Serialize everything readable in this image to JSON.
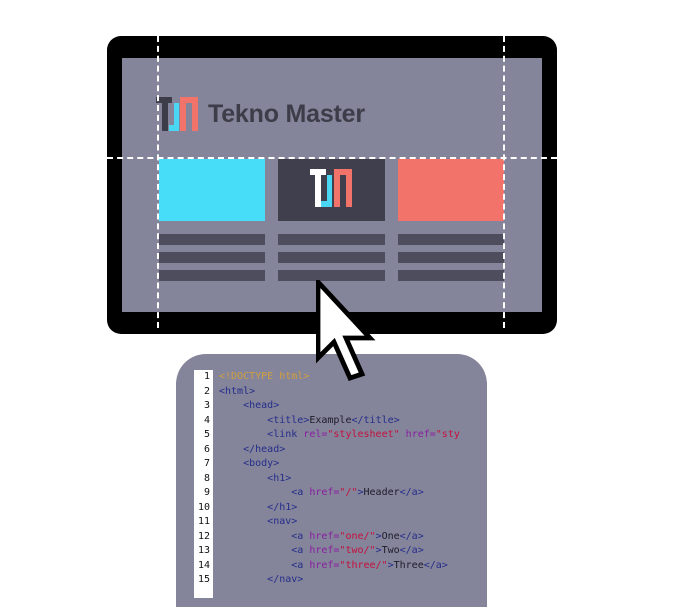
{
  "brand": {
    "name": "Tekno Master"
  },
  "colors": {
    "monitor_frame": "#000000",
    "screen_bg": "#84849a",
    "card_cyan": "#47dcf7",
    "card_dark": "#3f3f4d",
    "card_coral": "#f2736a",
    "text_bars": "#4d4d5e",
    "editor_bg": "#84849a"
  },
  "code": {
    "lines": [
      {
        "n": "1",
        "indent": "",
        "tokens": [
          {
            "k": "d",
            "v": "<!DOCTYPE html>"
          }
        ]
      },
      {
        "n": "2",
        "indent": "",
        "tokens": [
          {
            "k": "t",
            "v": "<html>"
          }
        ]
      },
      {
        "n": "3",
        "indent": "    ",
        "tokens": [
          {
            "k": "t",
            "v": "<head>"
          }
        ]
      },
      {
        "n": "4",
        "indent": "        ",
        "tokens": [
          {
            "k": "t",
            "v": "<title>"
          },
          {
            "k": "p",
            "v": "Example"
          },
          {
            "k": "t",
            "v": "</title>"
          }
        ]
      },
      {
        "n": "5",
        "indent": "        ",
        "tokens": [
          {
            "k": "t",
            "v": "<link "
          },
          {
            "k": "a",
            "v": "rel="
          },
          {
            "k": "s",
            "v": "\"stylesheet\" "
          },
          {
            "k": "a",
            "v": "href="
          },
          {
            "k": "s",
            "v": "\"sty"
          }
        ]
      },
      {
        "n": "6",
        "indent": "    ",
        "tokens": [
          {
            "k": "t",
            "v": "</head>"
          }
        ]
      },
      {
        "n": "7",
        "indent": "    ",
        "tokens": [
          {
            "k": "t",
            "v": "<body>"
          }
        ]
      },
      {
        "n": "8",
        "indent": "        ",
        "tokens": [
          {
            "k": "t",
            "v": "<h1>"
          }
        ]
      },
      {
        "n": "9",
        "indent": "            ",
        "tokens": [
          {
            "k": "t",
            "v": "<a "
          },
          {
            "k": "a",
            "v": "href="
          },
          {
            "k": "s",
            "v": "\"/\""
          },
          {
            "k": "t",
            "v": ">"
          },
          {
            "k": "p",
            "v": "Header"
          },
          {
            "k": "t",
            "v": "</a>"
          }
        ]
      },
      {
        "n": "10",
        "indent": "        ",
        "tokens": [
          {
            "k": "t",
            "v": "</h1>"
          }
        ]
      },
      {
        "n": "11",
        "indent": "        ",
        "tokens": [
          {
            "k": "t",
            "v": "<nav>"
          }
        ]
      },
      {
        "n": "12",
        "indent": "            ",
        "tokens": [
          {
            "k": "t",
            "v": "<a "
          },
          {
            "k": "a",
            "v": "href="
          },
          {
            "k": "s",
            "v": "\"one/\""
          },
          {
            "k": "t",
            "v": ">"
          },
          {
            "k": "p",
            "v": "One"
          },
          {
            "k": "t",
            "v": "</a>"
          }
        ]
      },
      {
        "n": "13",
        "indent": "            ",
        "tokens": [
          {
            "k": "t",
            "v": "<a "
          },
          {
            "k": "a",
            "v": "href="
          },
          {
            "k": "s",
            "v": "\"two/\""
          },
          {
            "k": "t",
            "v": ">"
          },
          {
            "k": "p",
            "v": "Two"
          },
          {
            "k": "t",
            "v": "</a>"
          }
        ]
      },
      {
        "n": "14",
        "indent": "            ",
        "tokens": [
          {
            "k": "t",
            "v": "<a "
          },
          {
            "k": "a",
            "v": "href="
          },
          {
            "k": "s",
            "v": "\"three/\""
          },
          {
            "k": "t",
            "v": ">"
          },
          {
            "k": "p",
            "v": "Three"
          },
          {
            "k": "t",
            "v": "</a>"
          }
        ]
      },
      {
        "n": "15",
        "indent": "        ",
        "tokens": [
          {
            "k": "t",
            "v": "</nav>"
          }
        ]
      }
    ]
  }
}
